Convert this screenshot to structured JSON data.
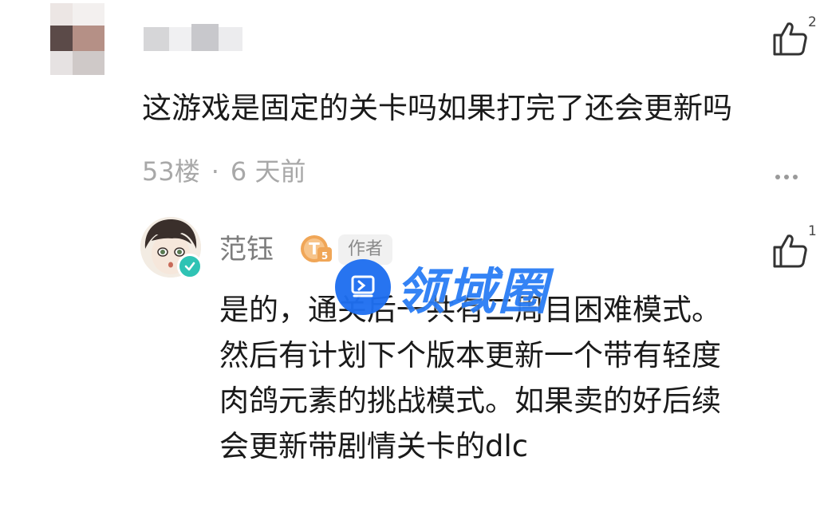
{
  "comment": {
    "text": "这游戏是固定的关卡吗如果打完了还会更新吗",
    "floor": "53楼",
    "separator": "·",
    "time": "6 天前",
    "like_count": "2",
    "icons": {
      "like": "thumbs-up-icon",
      "more": "more-dots-icon"
    }
  },
  "reply": {
    "author": "范钰",
    "level_badge": "T5",
    "author_tag": "作者",
    "like_count": "1",
    "lines": [
      "是的，通关后一共有二周目困难模式。",
      "然后有计划下个版本更新一个带有轻度",
      "肉鸽元素的挑战模式。如果卖的好后续",
      "会更新带剧情关卡的dlc"
    ],
    "icons": {
      "verified": "verified-check-icon",
      "like": "thumbs-up-icon"
    }
  },
  "watermark": {
    "text": "领域圈",
    "icon": "watermark-logo-icon",
    "color": "#2a7df5"
  },
  "colors": {
    "meta_gray": "#a8a8a8",
    "name_gray": "#7d7d7d",
    "verified_teal": "#2fc3b4",
    "level_orange": "#f0a657"
  }
}
